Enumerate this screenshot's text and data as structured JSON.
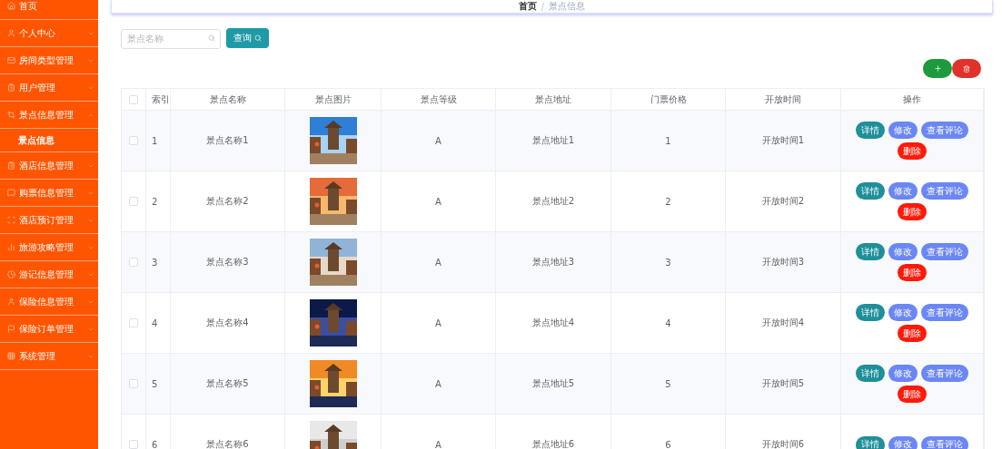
{
  "sidebar": {
    "items": [
      {
        "label": "首页",
        "selected": false
      },
      {
        "label": "个人中心",
        "expanded": false,
        "selected": false
      },
      {
        "label": "房间类型管理",
        "expanded": false,
        "selected": false
      },
      {
        "label": "用户管理",
        "expanded": false,
        "selected": false
      },
      {
        "label": "景点信息管理",
        "expanded": true,
        "selected": false,
        "children": [
          {
            "label": "景点信息",
            "selected": true
          }
        ]
      },
      {
        "label": "酒店信息管理",
        "expanded": false,
        "selected": false
      },
      {
        "label": "购票信息管理",
        "expanded": false,
        "selected": false
      },
      {
        "label": "酒店预订管理",
        "expanded": false,
        "selected": false
      },
      {
        "label": "旅游攻略管理",
        "expanded": false,
        "selected": false
      },
      {
        "label": "游记信息管理",
        "expanded": false,
        "selected": false
      },
      {
        "label": "保险信息管理",
        "expanded": false,
        "selected": false
      },
      {
        "label": "保险订单管理",
        "expanded": false,
        "selected": false
      },
      {
        "label": "系统管理",
        "expanded": false,
        "selected": false
      }
    ]
  },
  "breadcrumb": {
    "items": [
      "首页",
      "景点信息"
    ],
    "separator": "/"
  },
  "search": {
    "placeholder": "景点名称",
    "button": "查询"
  },
  "table": {
    "all_checked": false,
    "columns": [
      "索引",
      "景点名称",
      "景点图片",
      "景点等级",
      "景点地址",
      "门票价格",
      "开放时间",
      "操作"
    ],
    "rows": [
      {
        "checked": false,
        "index": "1",
        "name": "景点名称1",
        "image": {
          "kind": "picture"
        },
        "level": "A",
        "address": "景点地址1",
        "price": "1",
        "open_time": "开放时间1",
        "actions": [
          "详情",
          "修改",
          "查看评论",
          "删除"
        ]
      },
      {
        "checked": false,
        "index": "2",
        "name": "景点名称2",
        "image": {
          "kind": "picture"
        },
        "level": "A",
        "address": "景点地址2",
        "price": "2",
        "open_time": "开放时间2",
        "actions": [
          "详情",
          "修改",
          "查看评论",
          "删除"
        ]
      },
      {
        "checked": false,
        "index": "3",
        "name": "景点名称3",
        "image": {
          "kind": "picture"
        },
        "level": "A",
        "address": "景点地址3",
        "price": "3",
        "open_time": "开放时间3",
        "actions": [
          "详情",
          "修改",
          "查看评论",
          "删除"
        ]
      },
      {
        "checked": false,
        "index": "4",
        "name": "景点名称4",
        "image": {
          "kind": "picture"
        },
        "level": "A",
        "address": "景点地址4",
        "price": "4",
        "open_time": "开放时间4",
        "actions": [
          "详情",
          "修改",
          "查看评论",
          "删除"
        ]
      },
      {
        "checked": false,
        "index": "5",
        "name": "景点名称5",
        "image": {
          "kind": "picture"
        },
        "level": "A",
        "address": "景点地址5",
        "price": "5",
        "open_time": "开放时间5",
        "actions": [
          "详情",
          "修改",
          "查看评论",
          "删除"
        ]
      },
      {
        "checked": false,
        "index": "6",
        "name": "景点名称6",
        "image": {
          "kind": "picture"
        },
        "level": "A",
        "address": "景点地址6",
        "price": "6",
        "open_time": "开放时间6",
        "actions": [
          "详情",
          "修改",
          "查看评论"
        ]
      }
    ]
  }
}
